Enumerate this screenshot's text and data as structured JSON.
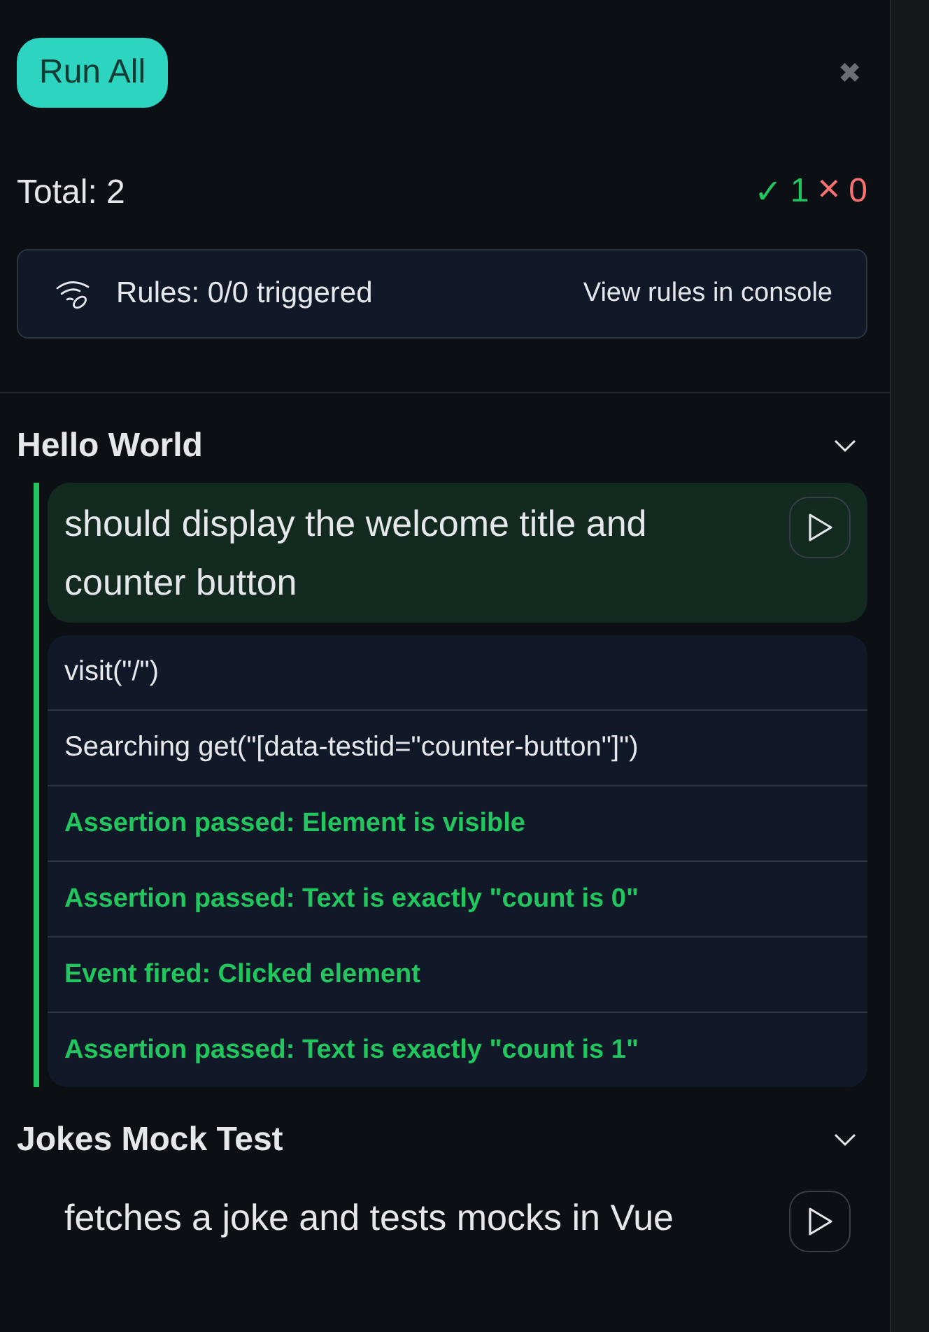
{
  "run_all_button": "Run All",
  "close_button": "✖",
  "summary": {
    "total": "Total: 2",
    "passed_mark": "✓",
    "passed_count": "1",
    "failed_mark": "×",
    "failed_count": "0"
  },
  "rules": {
    "text": "Rules: 0/0 triggered",
    "link": "View rules in console"
  },
  "suites": [
    {
      "title": "Hello World",
      "expanded": true,
      "tests": [
        {
          "name": "should display the welcome title and counter button",
          "passed": true,
          "steps": [
            {
              "kind": "log",
              "text": "visit(\"/\")"
            },
            {
              "kind": "log",
              "text": "Searching get(\"[data-testid=\"counter-button\"]\")"
            },
            {
              "kind": "success",
              "text": "Assertion passed: Element is visible"
            },
            {
              "kind": "success",
              "text": "Assertion passed: Text is exactly \"count is 0\""
            },
            {
              "kind": "success",
              "text": "Event fired: Clicked element"
            },
            {
              "kind": "success",
              "text": "Assertion passed: Text is exactly \"count is 1\""
            }
          ]
        }
      ]
    },
    {
      "title": "Jokes Mock Test",
      "expanded": true,
      "tests": [
        {
          "name": "fetches a joke and tests mocks in Vue",
          "passed": false
        }
      ]
    }
  ]
}
